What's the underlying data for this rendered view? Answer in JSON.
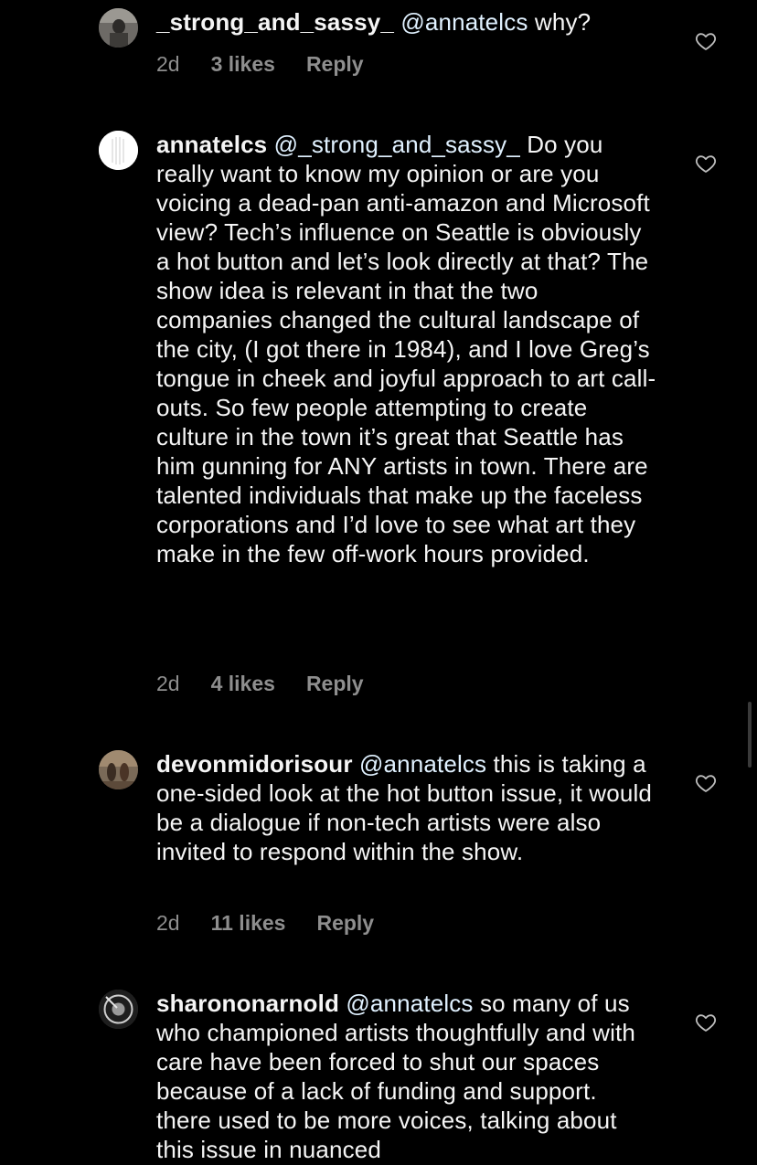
{
  "comments": [
    {
      "username": "_strong_and_sassy_",
      "mention": "@annatelcs",
      "text": " why?",
      "time": "2d",
      "likes": "3 likes",
      "reply": "Reply"
    },
    {
      "username": "annatelcs",
      "mention": "@_strong_and_sassy_",
      "text": " Do you really want to know my opinion or are you voicing a dead-pan anti-amazon and Microsoft view? Tech’s influence on Seattle is obviously a hot button and let’s look directly at that? The show idea is relevant in that the two companies changed the cultural landscape of the city, (I got there in 1984), and I love Greg’s tongue in cheek and joyful approach to art call-outs. So few people attempting to create culture in the town it’s great that Seattle has him gunning for ANY artists in town. There are talented individuals that make up the faceless corporations and I’d love to see what art they make in the few off-work hours provided.",
      "time": "2d",
      "likes": "4 likes",
      "reply": "Reply"
    },
    {
      "username": "devonmidorisour",
      "mention": "@annatelcs",
      "text": " this is taking a one-sided look at the hot button issue, it would be a dialogue if non-tech artists were also invited to respond within the show.",
      "time": "2d",
      "likes": "11 likes",
      "reply": "Reply"
    },
    {
      "username": "sharononarnold",
      "mention": "@annatelcs",
      "text": " so many of us who championed artists thoughtfully and with care have been forced to shut our spaces because of a lack of funding and support. there used to be more voices, talking about this issue in nuanced",
      "time": "",
      "likes": "",
      "reply": ""
    }
  ]
}
